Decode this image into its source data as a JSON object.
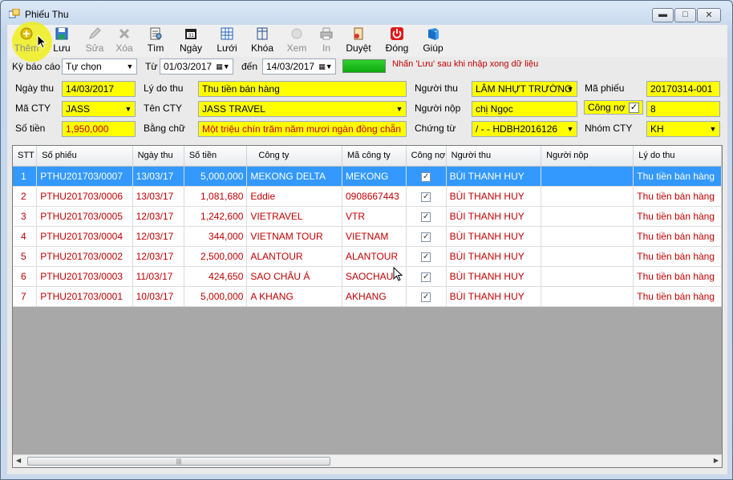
{
  "window": {
    "title": "Phiếu Thu"
  },
  "toolbar": {
    "items": [
      {
        "label": "Thêm",
        "icon": "add-icon",
        "enabled": false
      },
      {
        "label": "Lưu",
        "icon": "save-icon",
        "enabled": true
      },
      {
        "label": "Sửa",
        "icon": "edit-icon",
        "enabled": false
      },
      {
        "label": "Xóa",
        "icon": "delete-icon",
        "enabled": false
      },
      {
        "label": "Tìm",
        "icon": "search-icon",
        "enabled": true
      },
      {
        "label": "Ngày",
        "icon": "calendar-icon",
        "enabled": true
      },
      {
        "label": "Lưới",
        "icon": "grid-icon",
        "enabled": true
      },
      {
        "label": "Khóa",
        "icon": "lock-icon",
        "enabled": true
      },
      {
        "label": "Xem",
        "icon": "preview-icon",
        "enabled": false
      },
      {
        "label": "In",
        "icon": "print-icon",
        "enabled": false
      },
      {
        "label": "Duyệt",
        "icon": "approve-icon",
        "enabled": true
      },
      {
        "label": "Đóng",
        "icon": "power-icon",
        "enabled": true
      },
      {
        "label": "Giúp",
        "icon": "help-icon",
        "enabled": true
      }
    ]
  },
  "filter": {
    "period_label": "Kỳ báo cáo",
    "period_value": "Tự chọn",
    "from_label": "Từ",
    "from_value": "01/03/2017",
    "to_label": "đến",
    "to_value": "14/03/2017",
    "progress": 1.0,
    "notice": "Nhấn 'Lưu' sau khi nhập xong dữ liệu"
  },
  "form": {
    "ngay_thu_label": "Ngày thu",
    "ngay_thu_value": "14/03/2017",
    "ly_do_thu_label": "Lý do thu",
    "ly_do_thu_value": "Thu tiền bán hàng",
    "nguoi_thu_label": "Người thu",
    "nguoi_thu_value": "LÂM NHỰT TRƯỜNG",
    "ma_phieu_label": "Mã phiếu",
    "ma_phieu_value": "20170314-001",
    "ma_cty_label": "Mã CTY",
    "ma_cty_value": "JASS",
    "ten_cty_label": "Tên CTY",
    "ten_cty_value": "JASS TRAVEL",
    "nguoi_nop_label": "Người nộp",
    "nguoi_nop_value": "chị Ngọc",
    "cong_no_label": "Công nợ",
    "cong_no_checked": true,
    "cong_no_value": "8",
    "so_tien_label": "Số tiền",
    "so_tien_value": "1,950,000",
    "bang_chu_label": "Bằng chữ",
    "bang_chu_value": "Một triệu chín trăm năm mươi ngàn đồng chẵn",
    "chung_tu_label": "Chứng từ",
    "chung_tu_value": "/ - -  HDBH2016126",
    "nhom_cty_label": "Nhóm CTY",
    "nhom_cty_value": "KH"
  },
  "grid": {
    "columns": [
      "STT",
      "Số phiếu",
      "Ngày thu",
      "Số tiền",
      "Công ty",
      "Mã công ty",
      "Công nợ",
      "Người thu",
      "Người nộp",
      "Lý do thu"
    ],
    "rows": [
      {
        "stt": "1",
        "so_phieu": "PTHU201703/0007",
        "ngay_thu": "13/03/17",
        "so_tien": "5,000,000",
        "cong_ty": "MEKONG DELTA",
        "ma_cong_ty": "MEKONG",
        "cong_no": true,
        "nguoi_thu": "BÙI THANH HUY",
        "nguoi_nop": "",
        "ly_do_thu": "Thu tiền bán hàng",
        "selected": true
      },
      {
        "stt": "2",
        "so_phieu": "PTHU201703/0006",
        "ngay_thu": "13/03/17",
        "so_tien": "1,081,680",
        "cong_ty": "Eddie",
        "ma_cong_ty": "0908667443",
        "cong_no": true,
        "nguoi_thu": "BÙI THANH HUY",
        "nguoi_nop": "",
        "ly_do_thu": "Thu tiền bán hàng",
        "selected": false
      },
      {
        "stt": "3",
        "so_phieu": "PTHU201703/0005",
        "ngay_thu": "12/03/17",
        "so_tien": "1,242,600",
        "cong_ty": "VIETRAVEL",
        "ma_cong_ty": "VTR",
        "cong_no": true,
        "nguoi_thu": "BÙI THANH HUY",
        "nguoi_nop": "",
        "ly_do_thu": "Thu tiền bán hàng",
        "selected": false
      },
      {
        "stt": "4",
        "so_phieu": "PTHU201703/0004",
        "ngay_thu": "12/03/17",
        "so_tien": "344,000",
        "cong_ty": "VIETNAM TOUR",
        "ma_cong_ty": "VIETNAM",
        "cong_no": true,
        "nguoi_thu": "BÙI THANH HUY",
        "nguoi_nop": "",
        "ly_do_thu": "Thu tiền bán hàng",
        "selected": false
      },
      {
        "stt": "5",
        "so_phieu": "PTHU201703/0002",
        "ngay_thu": "12/03/17",
        "so_tien": "2,500,000",
        "cong_ty": "ALANTOUR",
        "ma_cong_ty": "ALANTOUR",
        "cong_no": true,
        "nguoi_thu": "BÙI THANH HUY",
        "nguoi_nop": "",
        "ly_do_thu": "Thu tiền bán hàng",
        "selected": false
      },
      {
        "stt": "6",
        "so_phieu": "PTHU201703/0003",
        "ngay_thu": "11/03/17",
        "so_tien": "424,650",
        "cong_ty": "SAO CHÂU Á",
        "ma_cong_ty": "SAOCHAU",
        "cong_no": true,
        "nguoi_thu": "BÙI THANH HUY",
        "nguoi_nop": "",
        "ly_do_thu": "Thu tiền bán hàng",
        "selected": false
      },
      {
        "stt": "7",
        "so_phieu": "PTHU201703/0001",
        "ngay_thu": "10/03/17",
        "so_tien": "5,000,000",
        "cong_ty": "A KHANG",
        "ma_cong_ty": "AKHANG",
        "cong_no": true,
        "nguoi_thu": "BÙI THANH HUY",
        "nguoi_nop": "",
        "ly_do_thu": "Thu tiền bán hàng",
        "selected": false
      }
    ]
  },
  "colors": {
    "highlight_field": "#ffff00",
    "row_text": "#c00000",
    "selected_row": "#3399ff",
    "progress": "#1bbf1b"
  }
}
